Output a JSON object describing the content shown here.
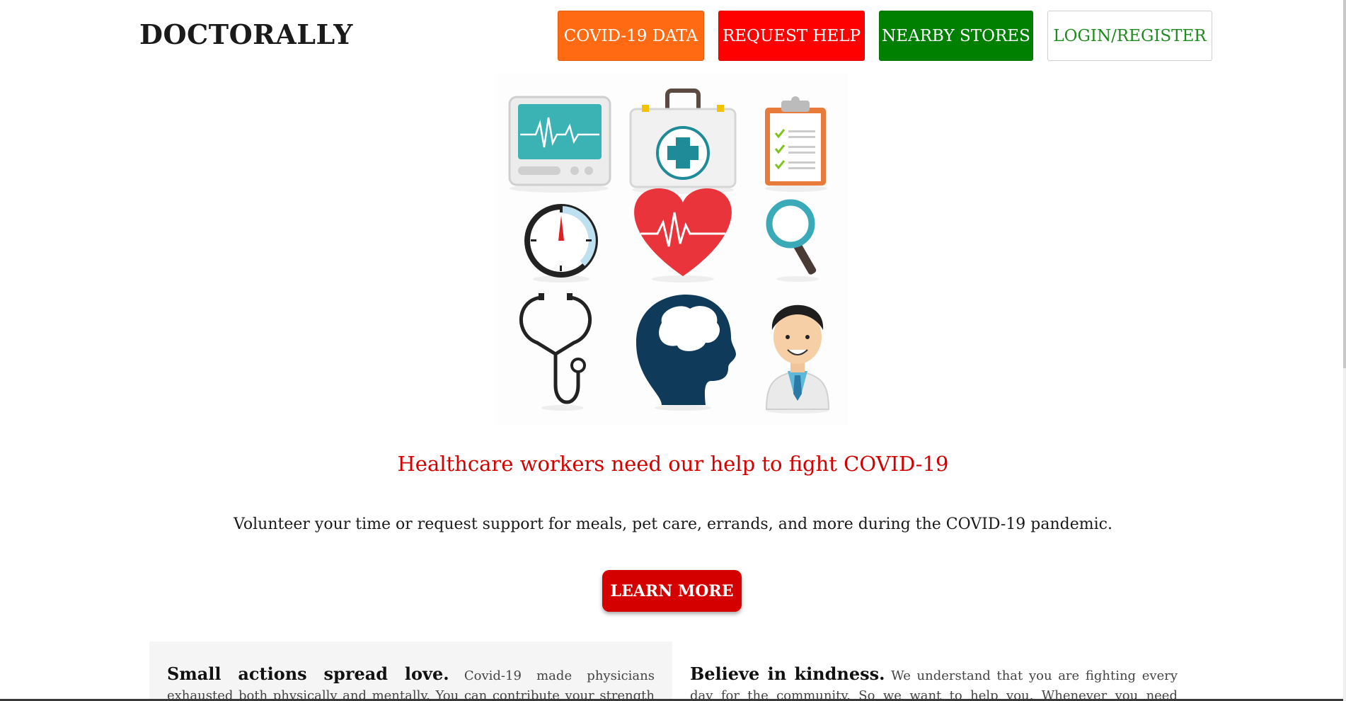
{
  "header": {
    "brand": "DOCTORALLY",
    "nav": {
      "covid_data": "COVID-19 DATA",
      "request_help": "REQUEST HELP",
      "nearby_stores": "NEARBY STORES",
      "login_register": "LOGIN/REGISTER"
    }
  },
  "colors": {
    "covid_button": "#ff6a13",
    "help_button": "#ff0000",
    "stores_button": "#008000",
    "headline": "#d40000",
    "learn_more": "#d40000"
  },
  "hero": {
    "icons": [
      "heart-monitor-icon",
      "first-aid-kit-icon",
      "clipboard-checklist-icon",
      "stopwatch-icon",
      "heartbeat-heart-icon",
      "magnifying-glass-icon",
      "stethoscope-icon",
      "brain-head-icon",
      "doctor-avatar-icon"
    ]
  },
  "main": {
    "headline": "Healthcare workers need our help to fight COVID-19",
    "subline": "Volunteer your time or request support for meals, pet care, errands, and more during the COVID-19 pandemic.",
    "cta": "LEARN MORE"
  },
  "cards": {
    "left": {
      "lead": "Small actions spread love.",
      "text": " Covid-19 made physicians exhausted both physically and mentally. You can contribute your strength to the fight against"
    },
    "right": {
      "lead": "Believe in kindness.",
      "text": " We understand that you are fighting every day for the community. So we want to help you. Whenever you need something, fill out the"
    }
  }
}
